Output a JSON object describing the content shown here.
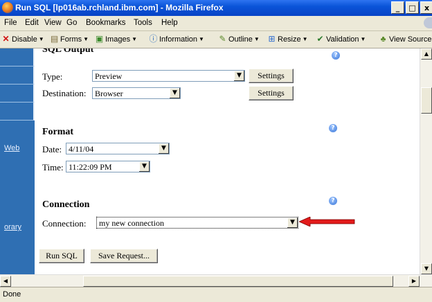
{
  "window": {
    "title": "Run SQL [lp016ab.rchland.ibm.com] - Mozilla Firefox",
    "minimize": "_",
    "maximize": "□",
    "close": "x"
  },
  "menu": [
    "File",
    "Edit",
    "View",
    "Go",
    "Bookmarks",
    "Tools",
    "Help"
  ],
  "toolbar": {
    "disable": "Disable",
    "forms": "Forms",
    "images": "Images",
    "information": "Information",
    "outline": "Outline",
    "resize": "Resize",
    "validation": "Validation",
    "view_source": "View Source"
  },
  "sidebar": {
    "links": [
      "Web",
      "orary"
    ]
  },
  "sql_output": {
    "heading": "SQL Output",
    "type_label": "Type:",
    "type_value": "Preview",
    "destination_label": "Destination:",
    "destination_value": "Browser",
    "settings_label": "Settings"
  },
  "format": {
    "heading": "Format",
    "date_label": "Date:",
    "date_value": "4/11/04",
    "time_label": "Time:",
    "time_value": "11:22:09 PM"
  },
  "connection": {
    "heading": "Connection",
    "label": "Connection:",
    "value": "my new connection"
  },
  "actions": {
    "run_sql": "Run SQL",
    "save_request": "Save Request..."
  },
  "status": "Done",
  "colors": {
    "sidebar": "#2f6fb3",
    "arrow": "#e31b1b",
    "titlebar": "#0a54d8"
  }
}
